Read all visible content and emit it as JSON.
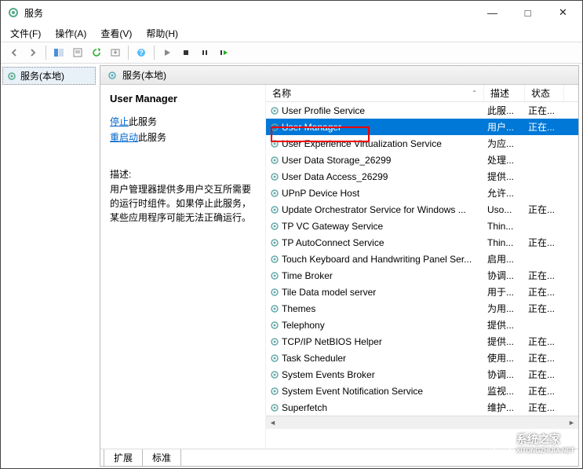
{
  "window": {
    "title": "服务",
    "min": "—",
    "max": "□",
    "close": "✕"
  },
  "menu": {
    "file": "文件(F)",
    "action": "操作(A)",
    "view": "查看(V)",
    "help": "帮助(H)"
  },
  "left_node": "服务(本地)",
  "panel_title": "服务(本地)",
  "selected_service": {
    "name": "User Manager",
    "stop_link": "停止",
    "stop_suffix": "此服务",
    "restart_link": "重启动",
    "restart_suffix": "此服务",
    "desc_label": "描述:",
    "desc": "用户管理器提供多用户交互所需要的运行时组件。如果停止此服务，某些应用程序可能无法正确运行。"
  },
  "columns": {
    "name": "名称",
    "desc": "描述",
    "status": "状态"
  },
  "rows": [
    {
      "name": "User Profile Service",
      "desc": "此服...",
      "status": "正在..."
    },
    {
      "name": "User Manager",
      "desc": "用户...",
      "status": "正在...",
      "selected": true
    },
    {
      "name": "User Experience Virtualization Service",
      "desc": "为应...",
      "status": ""
    },
    {
      "name": "User Data Storage_26299",
      "desc": "处理...",
      "status": ""
    },
    {
      "name": "User Data Access_26299",
      "desc": "提供...",
      "status": ""
    },
    {
      "name": "UPnP Device Host",
      "desc": "允许...",
      "status": ""
    },
    {
      "name": "Update Orchestrator Service for Windows ...",
      "desc": "Uso...",
      "status": "正在..."
    },
    {
      "name": "TP VC Gateway Service",
      "desc": "Thin...",
      "status": ""
    },
    {
      "name": "TP AutoConnect Service",
      "desc": "Thin...",
      "status": "正在..."
    },
    {
      "name": "Touch Keyboard and Handwriting Panel Ser...",
      "desc": "启用...",
      "status": ""
    },
    {
      "name": "Time Broker",
      "desc": "协调...",
      "status": "正在..."
    },
    {
      "name": "Tile Data model server",
      "desc": "用于...",
      "status": "正在..."
    },
    {
      "name": "Themes",
      "desc": "为用...",
      "status": "正在..."
    },
    {
      "name": "Telephony",
      "desc": "提供...",
      "status": ""
    },
    {
      "name": "TCP/IP NetBIOS Helper",
      "desc": "提供...",
      "status": "正在..."
    },
    {
      "name": "Task Scheduler",
      "desc": "使用...",
      "status": "正在..."
    },
    {
      "name": "System Events Broker",
      "desc": "协调...",
      "status": "正在..."
    },
    {
      "name": "System Event Notification Service",
      "desc": "监视...",
      "status": "正在..."
    },
    {
      "name": "Superfetch",
      "desc": "维护...",
      "status": "正在..."
    }
  ],
  "tabs": {
    "extended": "扩展",
    "standard": "标准"
  },
  "watermark": "系统之家",
  "watermark_url": "XITONGZHIJIA.NET"
}
